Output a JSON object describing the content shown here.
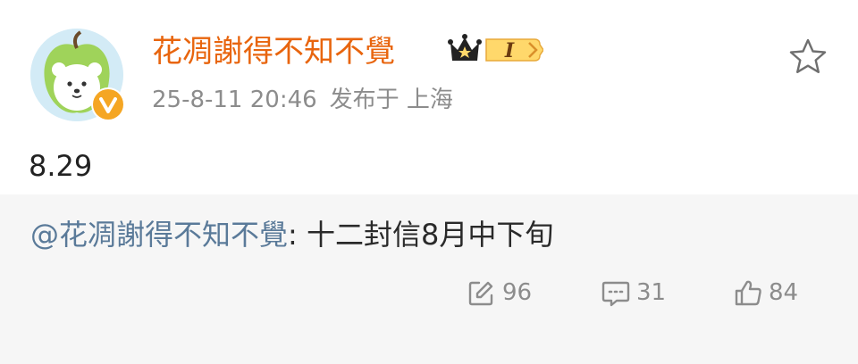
{
  "post": {
    "username": "花凋謝得不知不覺",
    "member_badge": "I",
    "time": "25-8-11 20:46",
    "location": "发布于 上海",
    "text": "8.29",
    "favorite_icon": "star-outline-icon"
  },
  "repost": {
    "mention": "@花凋謝得不知不覺",
    "separator": ": ",
    "text": "十二封信8月中下旬"
  },
  "actions": {
    "repost_count": "96",
    "comment_count": "31",
    "like_count": "84"
  },
  "colors": {
    "username": "#e8650e",
    "mention": "#5a7a99",
    "repost_background": "#f6f6f6",
    "verified": "#f5a623"
  },
  "icons": {
    "avatar": "apple-bear-avatar",
    "verified": "verified-v-icon",
    "member": "crown-icon",
    "repost": "repost-icon",
    "comment": "comment-icon",
    "like": "thumbs-up-icon"
  }
}
